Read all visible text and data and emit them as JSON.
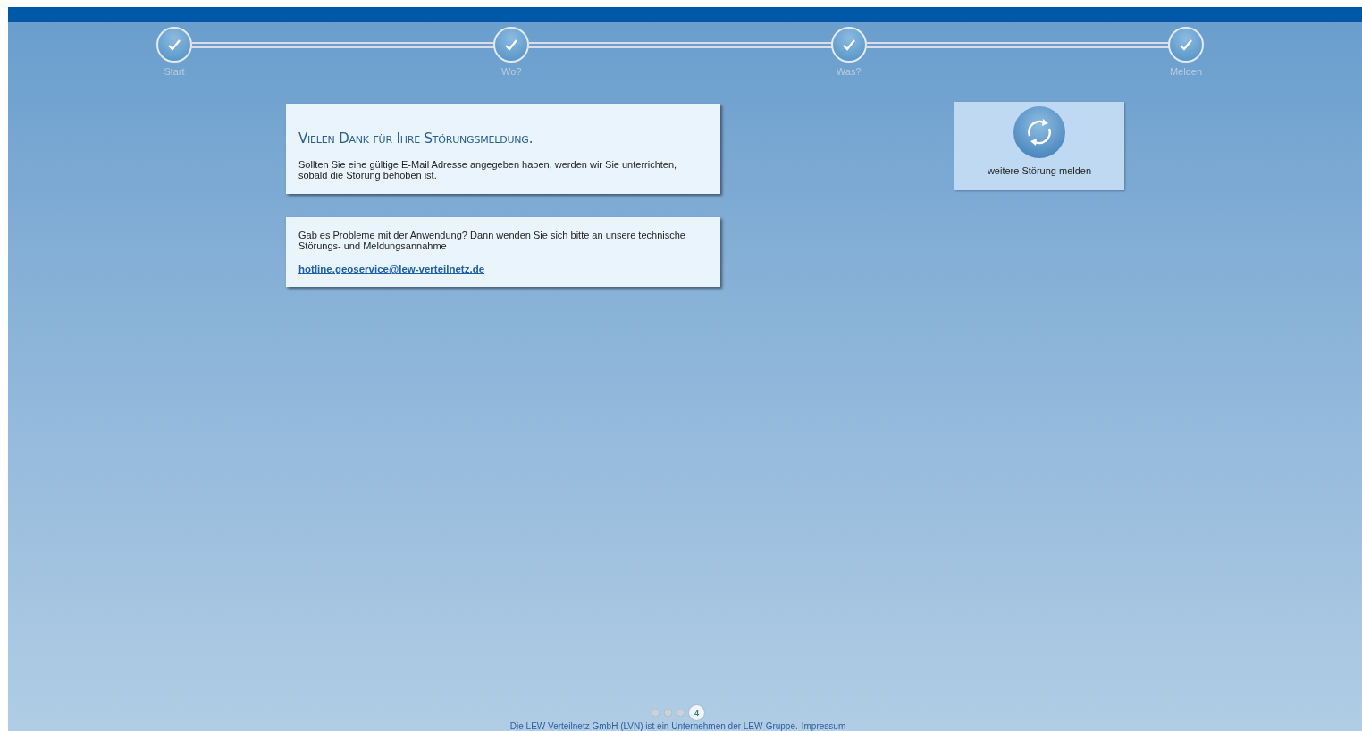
{
  "steps": [
    {
      "label": "Start",
      "done": true
    },
    {
      "label": "Wo?",
      "done": true
    },
    {
      "label": "Was?",
      "done": true
    },
    {
      "label": "Melden",
      "done": true
    }
  ],
  "thanks_card": {
    "title": "Vielen Dank für Ihre Störungsmeldung.",
    "text": "Sollten Sie eine gültige E-Mail Adresse angegeben haben, werden wir Sie unterrichten, sobald die Störung behoben ist."
  },
  "help_card": {
    "text": "Gab es Probleme mit der Anwendung? Dann wenden Sie sich bitte an unsere technische Störungs- und Meldungsannahme",
    "email": "hotline.geoservice@lew-verteilnetz.de"
  },
  "new_report_button": {
    "label": "weitere Störung melden"
  },
  "pager": [
    {
      "selected": false
    },
    {
      "selected": false
    },
    {
      "selected": false
    },
    {
      "label": "4",
      "selected": true
    }
  ],
  "footer": {
    "text": "Die LEW Verteilnetz GmbH (LVN) ist ein Unternehmen der LEW-Gruppe.",
    "link": "Impressum"
  }
}
